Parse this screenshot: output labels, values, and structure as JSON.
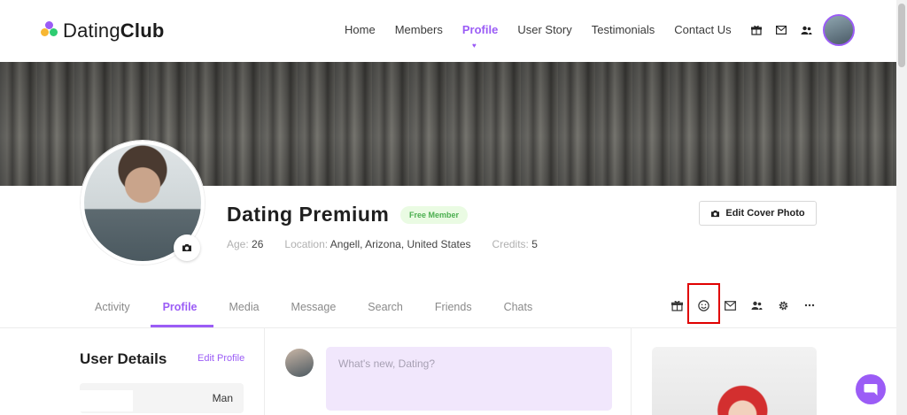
{
  "brand": {
    "name_light": "Dating",
    "name_bold": "Club"
  },
  "nav": {
    "items": [
      "Home",
      "Members",
      "Profile",
      "User Story",
      "Testimonials",
      "Contact Us"
    ],
    "active": "Profile"
  },
  "header_icons": [
    "gift-icon",
    "mail-icon",
    "friends-icon"
  ],
  "profile": {
    "name": "Dating Premium",
    "badge": "Free Member",
    "age_label": "Age:",
    "age": "26",
    "location_label": "Location:",
    "location": "Angell, Arizona, United States",
    "credits_label": "Credits:",
    "credits": "5",
    "edit_cover_label": "Edit Cover Photo"
  },
  "tabs": {
    "items": [
      "Activity",
      "Profile",
      "Media",
      "Message",
      "Search",
      "Friends",
      "Chats"
    ],
    "active": "Profile"
  },
  "tab_icons": [
    "gift-icon",
    "smile-icon",
    "mail-icon",
    "friends-icon",
    "settings-icon",
    "more-icon"
  ],
  "user_details": {
    "title": "User Details",
    "edit_label": "Edit Profile",
    "row_value": "Man"
  },
  "post": {
    "placeholder": "What's new, Dating?"
  },
  "colors": {
    "accent": "#9b5cf6",
    "badge_bg": "#eafbe3",
    "badge_text": "#4caf50",
    "highlight": "#e00000"
  }
}
